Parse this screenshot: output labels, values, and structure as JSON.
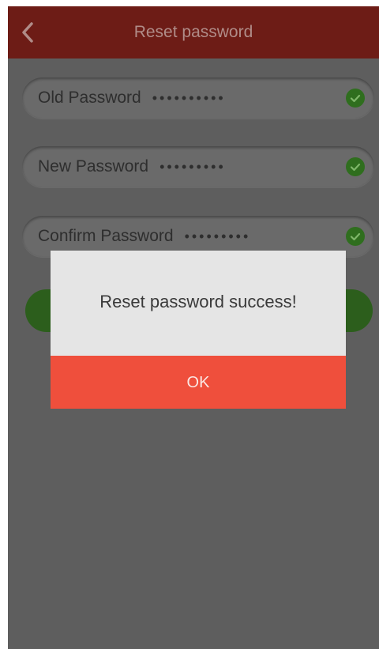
{
  "header": {
    "title": "Reset password",
    "back_icon": "chevron-left-icon"
  },
  "form": {
    "fields": [
      {
        "label": "Old Password",
        "value": "••••••••••",
        "status_icon": "check-circle-icon"
      },
      {
        "label": "New Password",
        "value": "•••••••••",
        "status_icon": "check-circle-icon"
      },
      {
        "label": "Confirm Password",
        "value": "•••••••••",
        "status_icon": "check-circle-icon"
      }
    ]
  },
  "dialog": {
    "message": "Reset password success!",
    "ok_label": "OK"
  },
  "colors": {
    "header_bg": "#6d1c16",
    "overlay_bg": "#5e5e5e",
    "dialog_bg": "#e5e5e5",
    "ok_button": "#ef4f3c",
    "check_green": "#2f6e1e"
  }
}
